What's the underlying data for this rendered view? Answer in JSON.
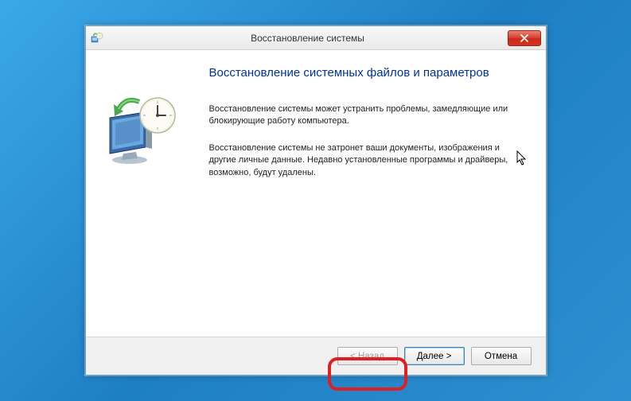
{
  "titlebar": {
    "title": "Восстановление системы"
  },
  "content": {
    "heading": "Восстановление системных файлов и параметров",
    "para1": "Восстановление системы может устранить проблемы, замедляющие или блокирующие работу компьютера.",
    "para2": "Восстановление системы не затронет ваши документы, изображения и другие личные данные. Недавно установленные программы и драйверы, возможно, будут удалены."
  },
  "buttons": {
    "back": "< Назад",
    "next": "Далее >",
    "cancel": "Отмена"
  },
  "icons": {
    "title_icon": "system-restore-icon",
    "close": "close-icon",
    "restore": "monitor-clock-restore-icon"
  }
}
